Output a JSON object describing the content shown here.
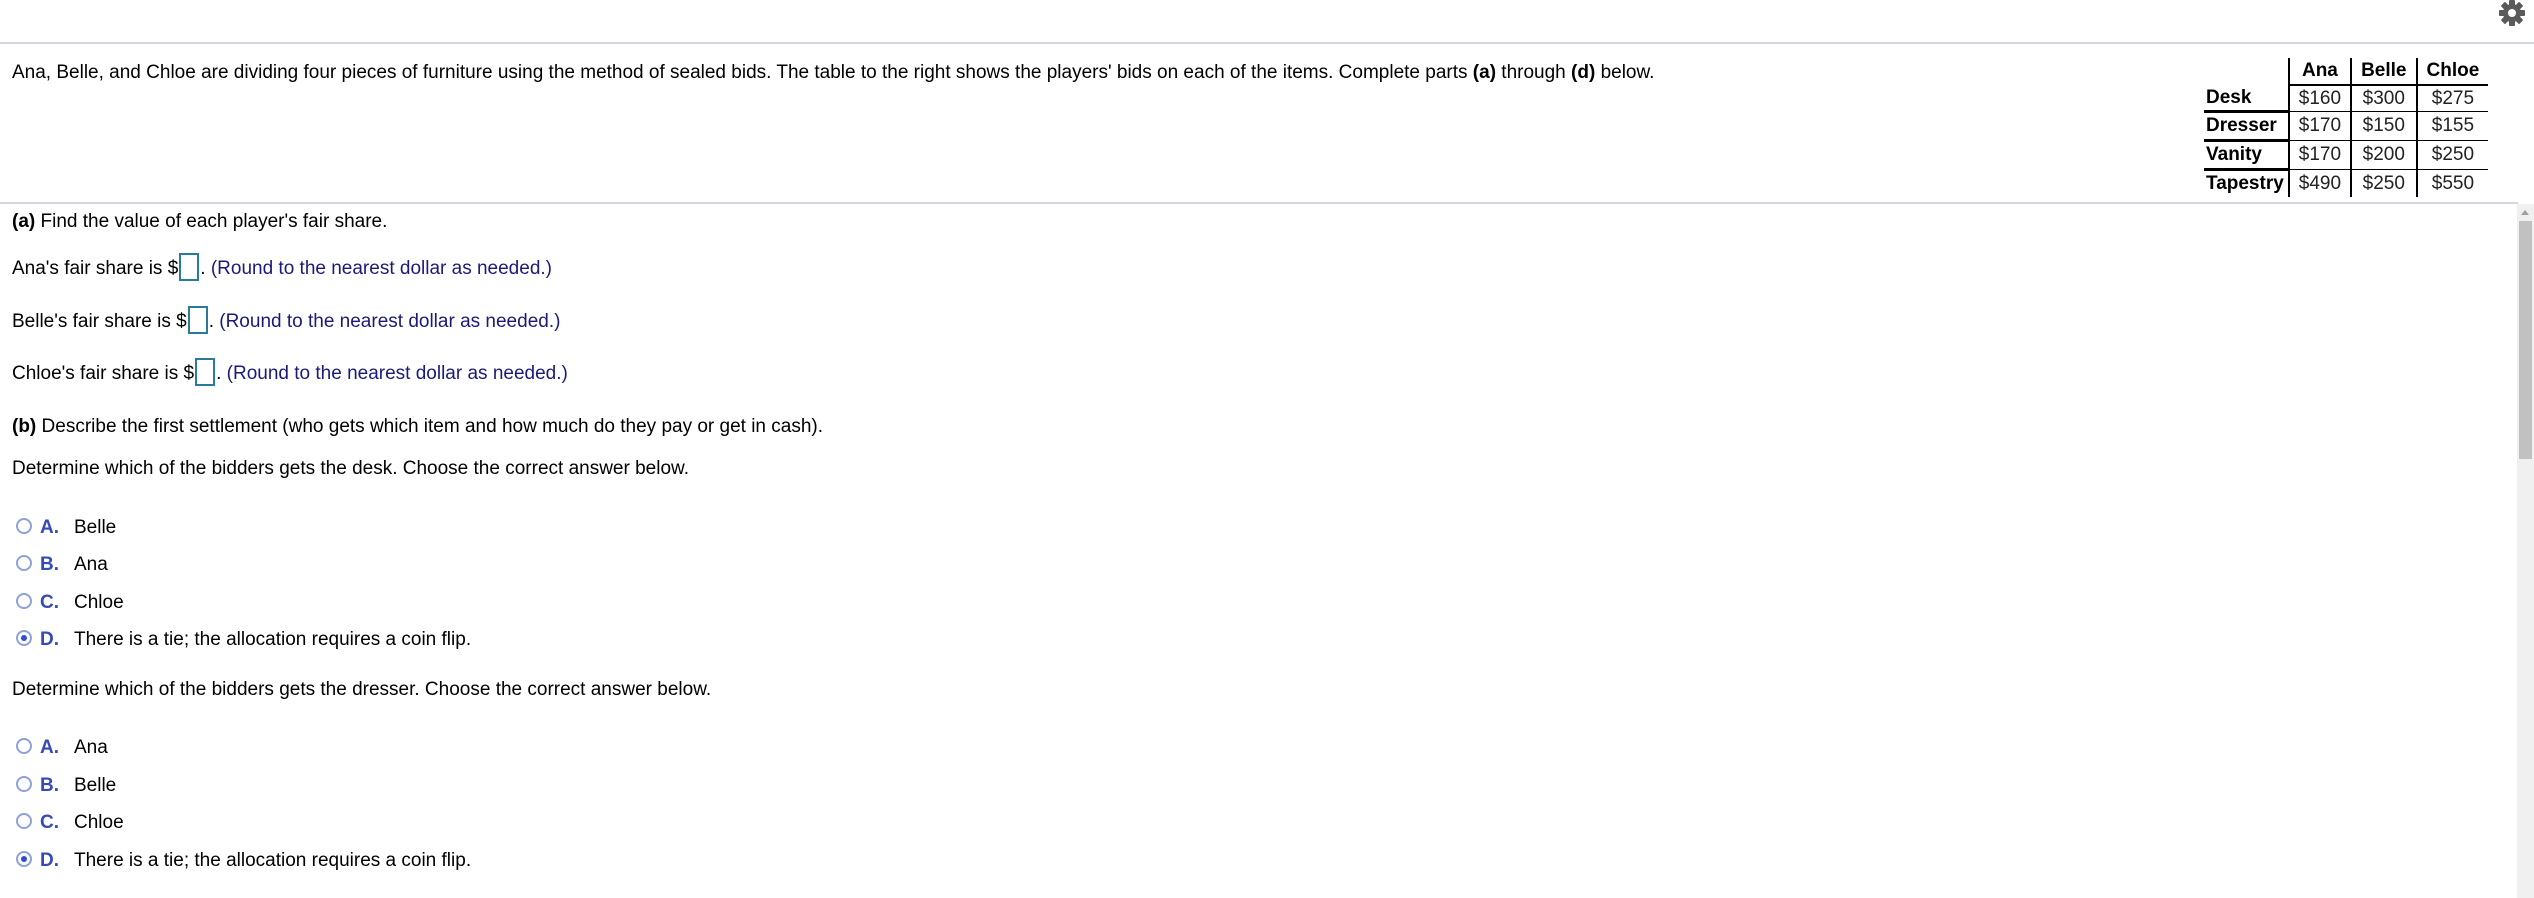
{
  "toolbar": {
    "settings_icon": "gear-icon"
  },
  "problem": {
    "statement_pre": "Ana, Belle, and Chloe are dividing four pieces of furniture using the method of sealed bids. The table to the right shows the players' bids on each of the items. Complete parts ",
    "part_first": "(a)",
    "statement_mid": " through ",
    "part_last": "(d)",
    "statement_post": " below."
  },
  "bids_table": {
    "columns": [
      "Ana",
      "Belle",
      "Chloe"
    ],
    "rows": [
      {
        "item": "Desk",
        "bids": [
          "$160",
          "$300",
          "$275"
        ]
      },
      {
        "item": "Dresser",
        "bids": [
          "$170",
          "$150",
          "$155"
        ]
      },
      {
        "item": "Vanity",
        "bids": [
          "$170",
          "$200",
          "$250"
        ]
      },
      {
        "item": "Tapestry",
        "bids": [
          "$490",
          "$250",
          "$550"
        ]
      }
    ]
  },
  "part_a": {
    "label": "(a)",
    "prompt": " Find the value of each player's fair share.",
    "fields": [
      {
        "prefix": "Ana's fair share is $",
        "value": "",
        "suffix_dot": ".",
        "hint": " (Round to the nearest dollar as needed.)"
      },
      {
        "prefix": "Belle's fair share is $",
        "value": "",
        "suffix_dot": ".",
        "hint": " (Round to the nearest dollar as needed.)"
      },
      {
        "prefix": "Chloe's fair share is $",
        "value": "",
        "suffix_dot": ".",
        "hint": " (Round to the nearest dollar as needed.)"
      }
    ]
  },
  "part_b": {
    "label": "(b)",
    "prompt": " Describe the first settlement (who gets which item and how much do they pay or get in cash).",
    "questions": [
      {
        "text": "Determine which of the bidders gets the desk. Choose the correct answer below.",
        "selected": "D",
        "options": [
          {
            "letter": "A.",
            "text": "Belle"
          },
          {
            "letter": "B.",
            "text": "Ana"
          },
          {
            "letter": "C.",
            "text": "Chloe"
          },
          {
            "letter": "D.",
            "text": "There is a tie; the allocation requires a coin flip."
          }
        ]
      },
      {
        "text": "Determine which of the bidders gets the dresser. Choose the correct answer below.",
        "selected": "D",
        "options": [
          {
            "letter": "A.",
            "text": "Ana"
          },
          {
            "letter": "B.",
            "text": "Belle"
          },
          {
            "letter": "C.",
            "text": "Chloe"
          },
          {
            "letter": "D.",
            "text": "There is a tie; the allocation requires a coin flip."
          }
        ]
      }
    ]
  },
  "colors": {
    "hint_text": "#1a1a7a",
    "option_letter": "#3549b9",
    "radio_selected": "#2b4fcf",
    "answer_box_border": "#2a7a9a",
    "divider": "#d2d6e0"
  }
}
